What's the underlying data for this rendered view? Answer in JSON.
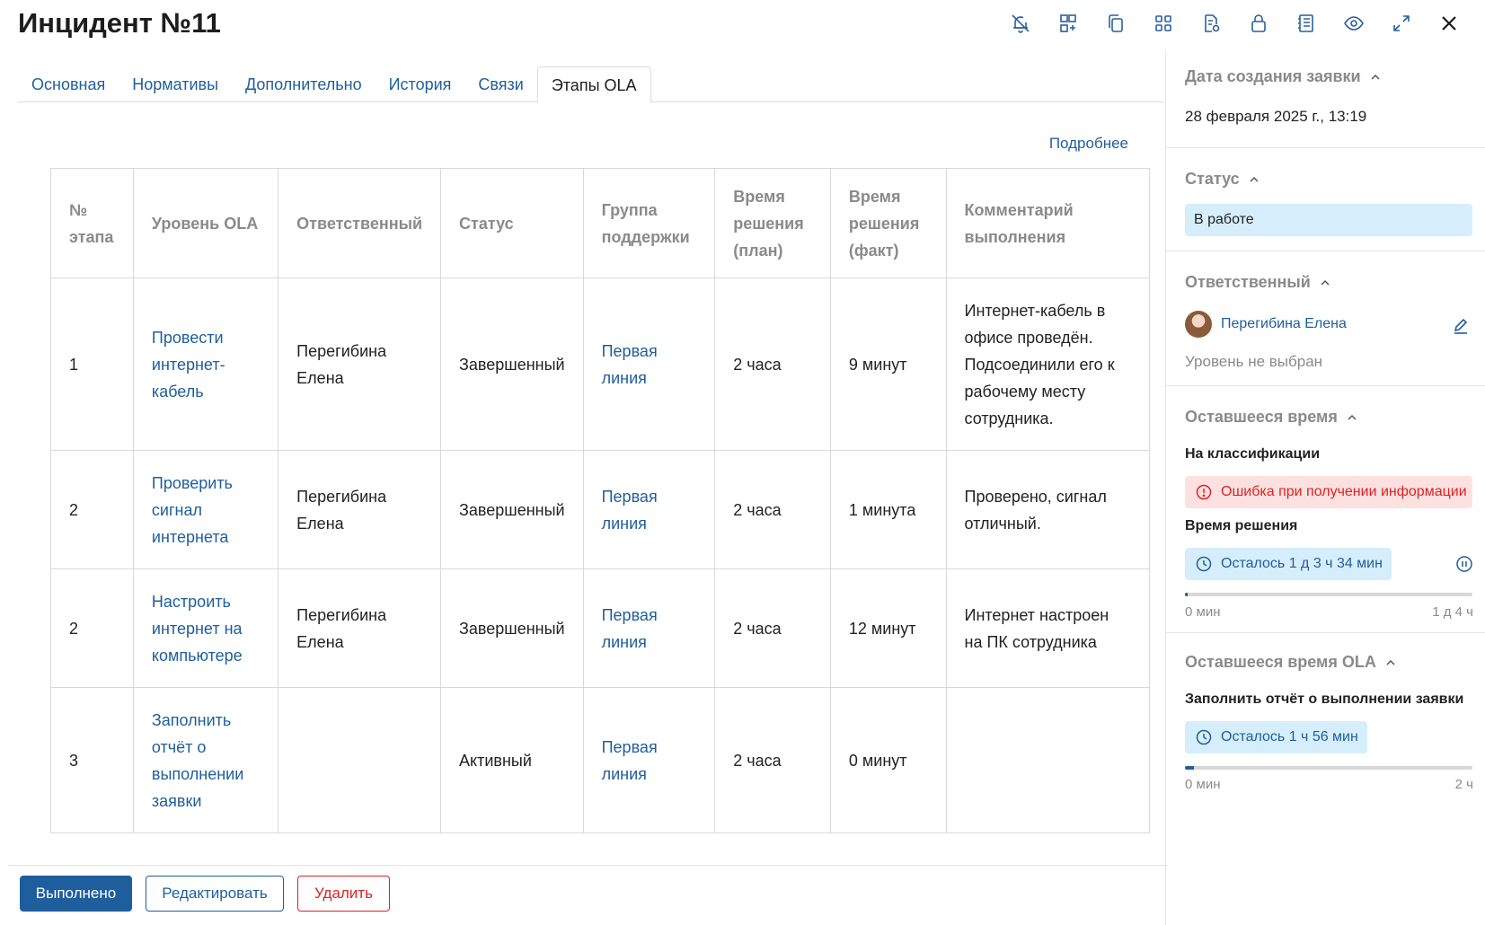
{
  "title": "Инцидент №11",
  "toolbar": {
    "icons": [
      "bell-off-icon",
      "reassign-icon",
      "copy-icon",
      "grid-icon",
      "document-settings-icon",
      "lock-icon",
      "journal-icon",
      "eye-icon",
      "expand-icon",
      "close-icon"
    ]
  },
  "tabs": [
    {
      "label": "Основная",
      "active": false
    },
    {
      "label": "Нормативы",
      "active": false
    },
    {
      "label": "Дополнительно",
      "active": false
    },
    {
      "label": "История",
      "active": false
    },
    {
      "label": "Связи",
      "active": false
    },
    {
      "label": "Этапы OLA",
      "active": true
    }
  ],
  "more_link": "Подробнее",
  "table": {
    "headers": [
      "№ этапа",
      "Уровень OLA",
      "Ответственный",
      "Статус",
      "Группа поддержки",
      "Время решения (план)",
      "Время решения (факт)",
      "Комментарий выполнения"
    ],
    "rows": [
      {
        "num": "1",
        "level": "Провести интернет-кабель",
        "responsible": "Перегибина Елена",
        "status": "Завершенный",
        "group": "Первая линия",
        "plan": "2 часа",
        "fact": "9 минут",
        "comment": "Интернет-кабель в офисе проведён. Подсоединили его к рабочему месту сотрудника."
      },
      {
        "num": "2",
        "level": "Проверить сигнал интернета",
        "responsible": "Перегибина Елена",
        "status": "Завершенный",
        "group": "Первая линия",
        "plan": "2 часа",
        "fact": "1 минута",
        "comment": "Проверено, сигнал отличный."
      },
      {
        "num": "2",
        "level": "Настроить интернет на компьютере",
        "responsible": "Перегибина Елена",
        "status": "Завершенный",
        "group": "Первая линия",
        "plan": "2 часа",
        "fact": "12 минут",
        "comment": "Интернет настроен на ПК сотрудника"
      },
      {
        "num": "3",
        "level": "Заполнить отчёт о выполнении заявки",
        "responsible": "",
        "status": "Активный",
        "group": "Первая линия",
        "plan": "2 часа",
        "fact": "0 минут",
        "comment": ""
      }
    ]
  },
  "buttons": {
    "done": "Выполнено",
    "edit": "Редактировать",
    "delete": "Удалить"
  },
  "sidebar": {
    "created": {
      "heading": "Дата создания заявки",
      "value": "28 февраля 2025 г., 13:19"
    },
    "status": {
      "heading": "Статус",
      "value": "В работе"
    },
    "responsible": {
      "heading": "Ответственный",
      "name": "Перегибина Елена",
      "level": "Уровень не выбран"
    },
    "remaining": {
      "heading": "Оставшееся время",
      "classification_label": "На классификации",
      "error": "Ошибка при получении информации",
      "resolution_label": "Время решения",
      "resolution_left": "Осталось 1 д 3 ч 34 мин",
      "progress": 0.01,
      "axis_min": "0 мин",
      "axis_max": "1 д 4 ч"
    },
    "ola": {
      "heading": "Оставшееся время OLA",
      "stage": "Заполнить отчёт о выполнении заявки",
      "left": "Осталось 1 ч 56 мин",
      "progress": 0.03,
      "axis_min": "0 мин",
      "axis_max": "2 ч"
    }
  },
  "colors": {
    "accent": "#1f5e9c",
    "danger": "#d22222",
    "status_bg": "#d6eefb",
    "error_bg": "#fde1e1"
  }
}
